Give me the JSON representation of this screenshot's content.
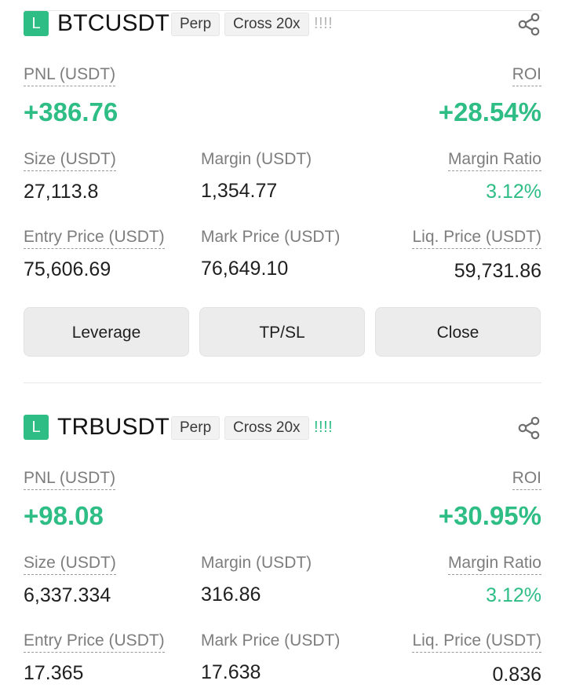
{
  "positions": [
    {
      "side_badge": "L",
      "symbol": "BTCUSDT",
      "type_tag": "Perp",
      "margin_mode_tag": "Cross 20x",
      "risk_indicator": "!!!!",
      "risk_color": "#b4b4b4",
      "pnl_label": "PNL (USDT)",
      "pnl_value": "+386.76",
      "roi_label": "ROI",
      "roi_value": "+28.54%",
      "size_label": "Size (USDT)",
      "size_value": "27,113.8",
      "margin_label": "Margin (USDT)",
      "margin_value": "1,354.77",
      "margin_ratio_label": "Margin Ratio",
      "margin_ratio_value": "3.12%",
      "entry_price_label": "Entry Price (USDT)",
      "entry_price_value": "75,606.69",
      "mark_price_label": "Mark Price (USDT)",
      "mark_price_value": "76,649.10",
      "liq_price_label": "Liq. Price (USDT)",
      "liq_price_value": "59,731.86",
      "buttons": [
        "Leverage",
        "TP/SL",
        "Close"
      ]
    },
    {
      "side_badge": "L",
      "symbol": "TRBUSDT",
      "type_tag": "Perp",
      "margin_mode_tag": "Cross 20x",
      "risk_indicator": "!!!!",
      "risk_color": "#2ebd85",
      "pnl_label": "PNL (USDT)",
      "pnl_value": "+98.08",
      "roi_label": "ROI",
      "roi_value": "+30.95%",
      "size_label": "Size (USDT)",
      "size_value": "6,337.334",
      "margin_label": "Margin (USDT)",
      "margin_value": "316.86",
      "margin_ratio_label": "Margin Ratio",
      "margin_ratio_value": "3.12%",
      "entry_price_label": "Entry Price (USDT)",
      "entry_price_value": "17.365",
      "mark_price_label": "Mark Price (USDT)",
      "mark_price_value": "17.638",
      "liq_price_label": "Liq. Price (USDT)",
      "liq_price_value": "0.836"
    }
  ],
  "colors": {
    "profit_green": "#2ebd85",
    "button_bg": "#ececec",
    "label_gray": "#7d7d7d"
  },
  "icons": {
    "share": "share-icon"
  }
}
